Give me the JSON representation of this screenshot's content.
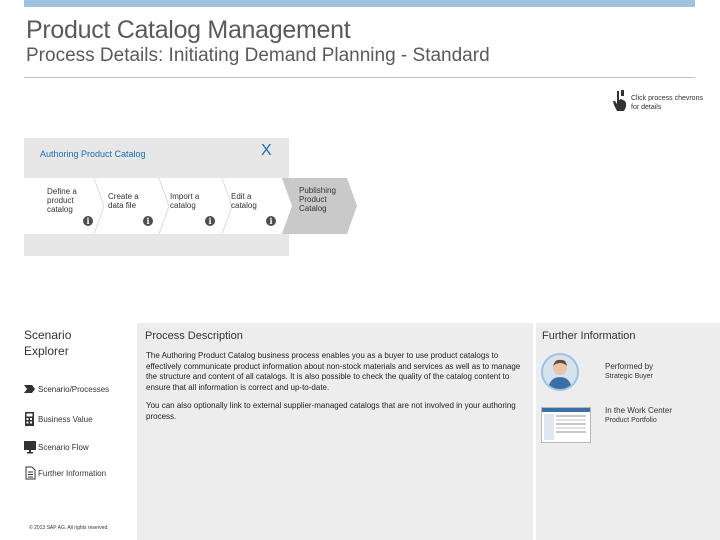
{
  "header": {
    "title": "Product Catalog Management",
    "subtitle": "Process Details: Initiating Demand Planning - Standard"
  },
  "hint": {
    "text": "Click process chevrons for details"
  },
  "flow": {
    "title": "Authoring Product Catalog",
    "close_label": "X",
    "steps": [
      {
        "label": "Define a product catalog",
        "info": "i"
      },
      {
        "label": "Create a data file",
        "info": "i"
      },
      {
        "label": "Import a catalog",
        "info": "i"
      },
      {
        "label": "Edit a catalog",
        "info": "i"
      },
      {
        "label": "Publishing Product Catalog"
      }
    ]
  },
  "explorer": {
    "title": "Scenario Explorer",
    "items": [
      {
        "label": "Scenario/Processes",
        "icon": "process-icon"
      },
      {
        "label": "Business Value",
        "icon": "calculator-icon"
      },
      {
        "label": "Scenario Flow",
        "icon": "monitor-icon"
      },
      {
        "label": "Further Information",
        "icon": "document-icon"
      }
    ],
    "copyright": "© 2013 SAP AG. All rights reserved."
  },
  "description": {
    "title": "Process Description",
    "p1": "The Authoring Product Catalog business process enables you as a buyer to use product catalogs to effectively communicate product information about non-stock materials and services as well as to manage the structure and content of all catalogs. It is also possible to check the quality of the catalog content to ensure that all information is correct and up-to-date.",
    "p2": "You can also optionally link to external supplier-managed catalogs that are not involved in your authoring process."
  },
  "further": {
    "title": "Further Information",
    "performed_by_label": "Performed by",
    "performed_by_value": "Strategic Buyer",
    "work_center_label": "In the Work Center",
    "work_center_value": "Product Portfolio"
  },
  "colors": {
    "accent": "#9fc2e3",
    "link": "#1b6fb8",
    "chevron_active": "#ffffff",
    "chevron_inactive": "#c9c9c9"
  }
}
